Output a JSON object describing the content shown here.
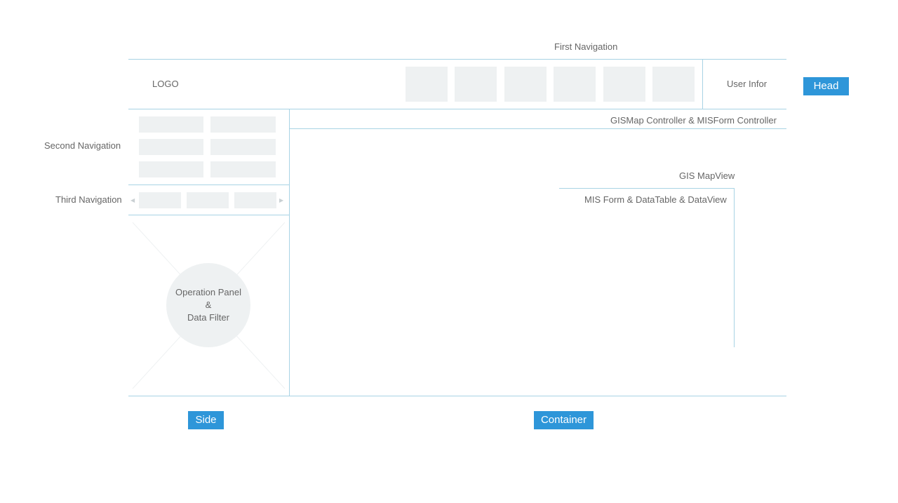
{
  "first_navigation": {
    "label": "First Navigation",
    "items": [
      "",
      "",
      "",
      "",
      "",
      ""
    ]
  },
  "head": {
    "logo": "LOGO",
    "user_info": "User Infor",
    "tag": "Head"
  },
  "side": {
    "second_navigation": "Second Navigation",
    "third_navigation": "Third Navigation",
    "operation_panel": {
      "line1": "Operation Panel",
      "line2": "&",
      "line3": "Data Filter"
    },
    "tag": "Side"
  },
  "container": {
    "controller": "GISMap Controller & MISForm Controller",
    "map_view": "GIS MapView",
    "mis_form": "MIS Form & DataTable & DataView",
    "tag": "Container"
  },
  "colors": {
    "line": "#a8d3e4",
    "placeholder": "#eef1f2",
    "tag": "#2e96d9"
  }
}
